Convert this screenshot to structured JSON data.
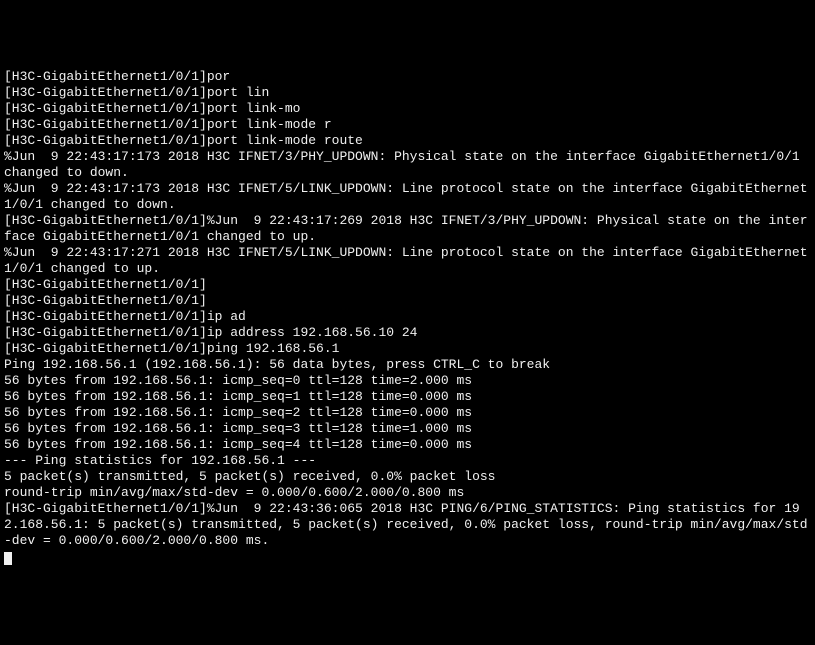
{
  "terminal": {
    "lines": [
      "[H3C-GigabitEthernet1/0/1]por",
      "[H3C-GigabitEthernet1/0/1]port lin",
      "[H3C-GigabitEthernet1/0/1]port link-mo",
      "[H3C-GigabitEthernet1/0/1]port link-mode r",
      "[H3C-GigabitEthernet1/0/1]port link-mode route",
      "%Jun  9 22:43:17:173 2018 H3C IFNET/3/PHY_UPDOWN: Physical state on the interface GigabitEthernet1/0/1 changed to down.",
      "%Jun  9 22:43:17:173 2018 H3C IFNET/5/LINK_UPDOWN: Line protocol state on the interface GigabitEthernet1/0/1 changed to down.",
      "[H3C-GigabitEthernet1/0/1]%Jun  9 22:43:17:269 2018 H3C IFNET/3/PHY_UPDOWN: Physical state on the interface GigabitEthernet1/0/1 changed to up.",
      "%Jun  9 22:43:17:271 2018 H3C IFNET/5/LINK_UPDOWN: Line protocol state on the interface GigabitEthernet1/0/1 changed to up.",
      "",
      "[H3C-GigabitEthernet1/0/1]",
      "[H3C-GigabitEthernet1/0/1]",
      "[H3C-GigabitEthernet1/0/1]ip ad",
      "[H3C-GigabitEthernet1/0/1]ip address 192.168.56.10 24",
      "[H3C-GigabitEthernet1/0/1]ping 192.168.56.1",
      "Ping 192.168.56.1 (192.168.56.1): 56 data bytes, press CTRL_C to break",
      "56 bytes from 192.168.56.1: icmp_seq=0 ttl=128 time=2.000 ms",
      "56 bytes from 192.168.56.1: icmp_seq=1 ttl=128 time=0.000 ms",
      "56 bytes from 192.168.56.1: icmp_seq=2 ttl=128 time=0.000 ms",
      "56 bytes from 192.168.56.1: icmp_seq=3 ttl=128 time=1.000 ms",
      "56 bytes from 192.168.56.1: icmp_seq=4 ttl=128 time=0.000 ms",
      "",
      "--- Ping statistics for 192.168.56.1 ---",
      "5 packet(s) transmitted, 5 packet(s) received, 0.0% packet loss",
      "round-trip min/avg/max/std-dev = 0.000/0.600/2.000/0.800 ms",
      "[H3C-GigabitEthernet1/0/1]%Jun  9 22:43:36:065 2018 H3C PING/6/PING_STATISTICS: Ping statistics for 192.168.56.1: 5 packet(s) transmitted, 5 packet(s) received, 0.0% packet loss, round-trip min/avg/max/std-dev = 0.000/0.600/2.000/0.800 ms."
    ]
  }
}
